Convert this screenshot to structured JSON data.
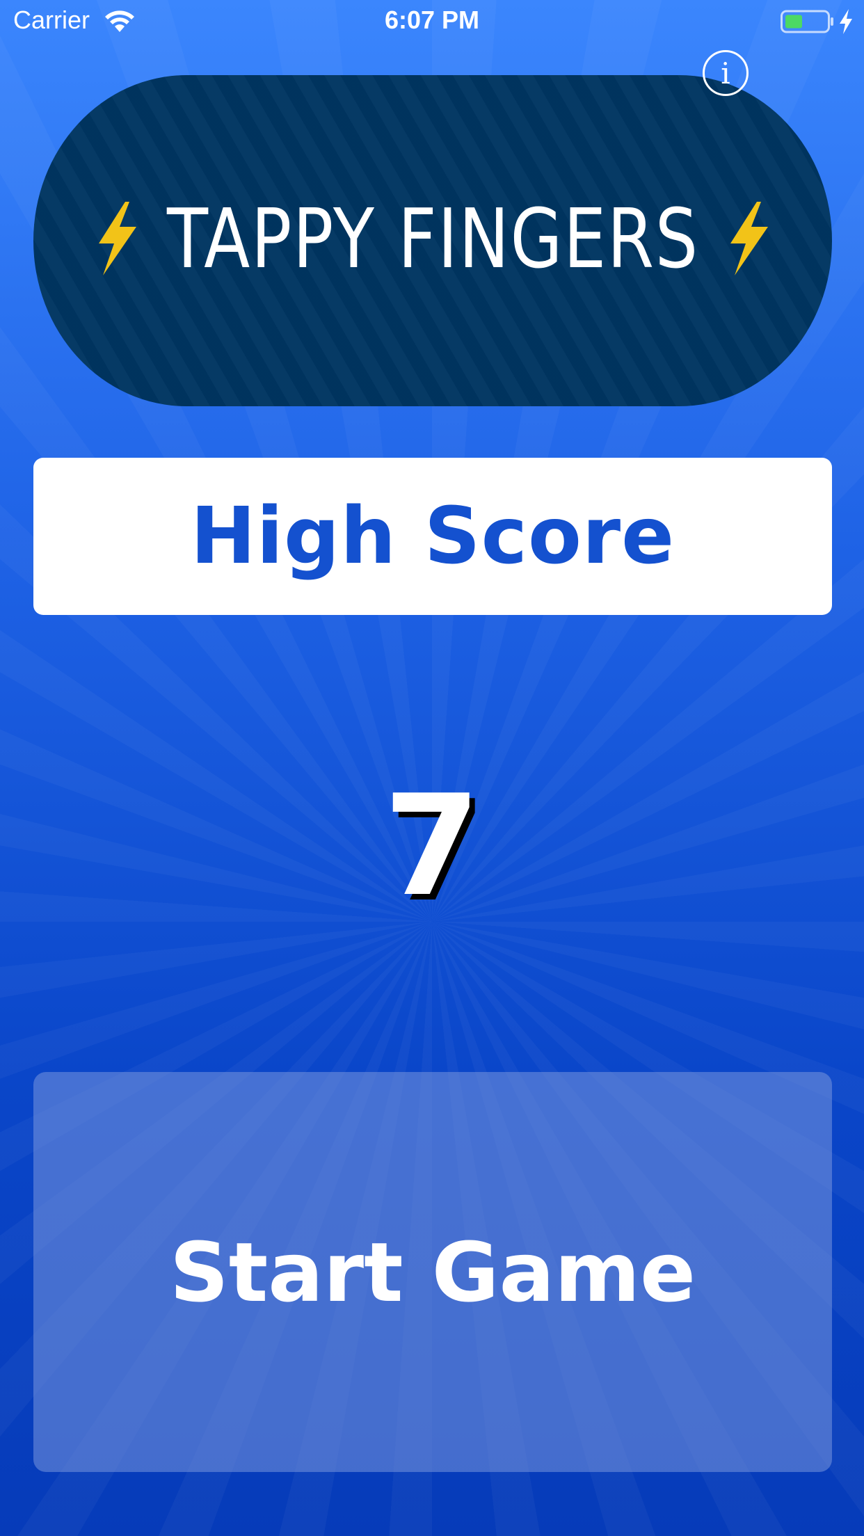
{
  "status_bar": {
    "carrier": "Carrier",
    "time": "6:07 PM",
    "wifi_icon": "wifi-icon",
    "battery_icon": "battery-charging-icon",
    "battery_color": "#4cd964"
  },
  "header": {
    "title": "TAPPY FINGERS",
    "lightning_icon": "lightning-icon",
    "lightning_color": "#f2c318",
    "banner_color": "#003561",
    "info_icon": "i"
  },
  "high_score": {
    "label": "High Score",
    "value": "7",
    "label_color": "#1451cf"
  },
  "actions": {
    "start_label": "Start Game"
  },
  "theme": {
    "background_top": "#3b86fd",
    "background_bottom": "#063bb9"
  }
}
